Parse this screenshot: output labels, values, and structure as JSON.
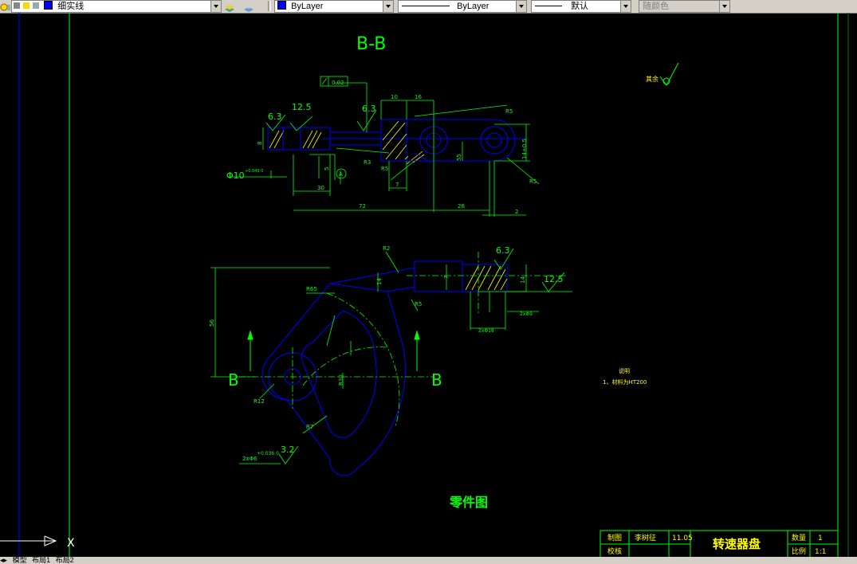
{
  "toolbar": {
    "layer_name": "细实线",
    "color": "ByLayer",
    "linetype": "ByLayer",
    "lineweight": "默认",
    "plotstyle": "随颜色"
  },
  "drawing": {
    "section_label": "B-B",
    "section_mark": "B",
    "part_title": "零件图",
    "roughness_marks": [
      "6.3",
      "12.5",
      "6.3",
      "6.3",
      "12.5",
      "3.2"
    ],
    "rest_note": "其余",
    "tolerance_frame": "0.02",
    "tolerance_datum": "A",
    "dimensions": {
      "d_10": "10",
      "d_16": "16",
      "d_30": "30",
      "d_72": "72",
      "d_28": "28",
      "d_2": "2",
      "d_7": "7",
      "d_5": "5",
      "d_55": "55",
      "d_8": "8",
      "d_14_05": "14±0.5",
      "d_phi10": "Φ10",
      "d_tol": "+0.049 0",
      "d_R3": "R3",
      "d_R5_a": "R5",
      "d_R5_b": "R5",
      "d_56": "56",
      "d_14": "14",
      "d_7b": "7",
      "d_R65": "R65",
      "d_hole": "2xΦ6",
      "d_hole_tol": "+0.036 0",
      "d_2x18": "2xΦ18",
      "d_2x9": "2xΦ9",
      "d_R5c": "R5",
      "d_R2": "R2",
      "d_R30": "R30",
      "d_R7": "R7",
      "d_R12": "R12"
    },
    "notes": {
      "title": "说明",
      "line1": "1、材料为HT200"
    }
  },
  "titleblock": {
    "drawn_label": "制图",
    "drawer": "李树征",
    "date": "11.05",
    "check_label": "校核",
    "part_name": "转速器盘",
    "qty_label": "数量",
    "qty": "1",
    "scale_label": "比例",
    "scale": "1:1"
  },
  "ucs": {
    "x_label": "X"
  },
  "statusbar": {
    "tabs": [
      "模型",
      "布局1",
      "布局2"
    ]
  },
  "colors": {
    "outline": "#0000ff",
    "dimension": "#00ff00",
    "frame": "#00ff00",
    "background": "#000000"
  }
}
